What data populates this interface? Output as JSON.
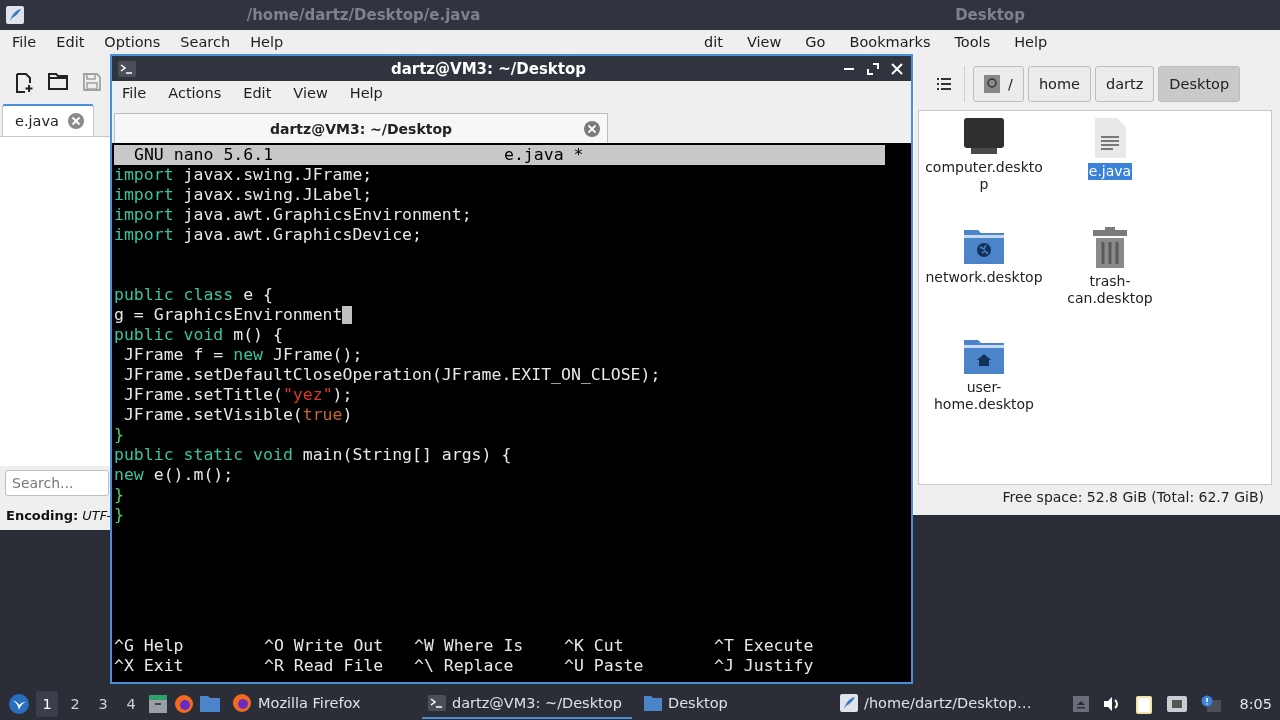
{
  "editor_window": {
    "title": "/home/dartz/Desktop/e.java",
    "menu": [
      "File",
      "Edit",
      "Options",
      "Search",
      "Help"
    ],
    "toolbar": [
      {
        "kind": "new",
        "disabled": false
      },
      {
        "kind": "open",
        "disabled": false
      },
      {
        "kind": "save",
        "disabled": true
      }
    ],
    "tabs": [
      {
        "label": "e.java",
        "selected": true
      }
    ],
    "search": {
      "placeholder": "Search..."
    },
    "status": {
      "label": "Encoding:",
      "value": "UTF-"
    }
  },
  "file_manager": {
    "title": "Desktop",
    "menu": [
      "dit",
      "View",
      "Go",
      "Bookmarks",
      "Tools",
      "Help"
    ],
    "path": [
      {
        "label": "/",
        "kind": "root",
        "selected": false
      },
      {
        "label": "home",
        "kind": "folder",
        "selected": false
      },
      {
        "label": "dartz",
        "kind": "folder",
        "selected": false
      },
      {
        "label": "Desktop",
        "kind": "folder",
        "selected": true
      }
    ],
    "items": [
      {
        "name": "computer.desktop",
        "kind": "computer",
        "selected": false
      },
      {
        "name": "e.java",
        "kind": "document",
        "selected": true
      },
      {
        "name": "network.desktop",
        "kind": "network",
        "selected": false
      },
      {
        "name": "trash-can.desktop",
        "kind": "trash",
        "selected": false
      },
      {
        "name": "user-home.desktop",
        "kind": "home",
        "selected": false
      }
    ],
    "status_bar": "Free space: 52.8 GiB (Total: 62.7 GiB)"
  },
  "terminal": {
    "title": "dartz@VM3: ~/Desktop",
    "menu": [
      "File",
      "Actions",
      "Edit",
      "View",
      "Help"
    ],
    "tabs": [
      {
        "label": "dartz@VM3: ~/Desktop",
        "selected": true
      }
    ],
    "nano": {
      "header_left": "GNU nano 5.6.1",
      "header_file": "e.java *",
      "lines": [
        {
          "cursor": false,
          "segments": [
            {
              "kind": "keyword",
              "text": "import"
            },
            {
              "kind": "plain",
              "text": " javax.swing.JFrame;"
            }
          ]
        },
        {
          "cursor": false,
          "segments": [
            {
              "kind": "keyword",
              "text": "import"
            },
            {
              "kind": "plain",
              "text": " javax.swing.JLabel;"
            }
          ]
        },
        {
          "cursor": false,
          "segments": [
            {
              "kind": "keyword",
              "text": "import"
            },
            {
              "kind": "plain",
              "text": " java.awt.GraphicsEnvironment;"
            }
          ]
        },
        {
          "cursor": false,
          "segments": [
            {
              "kind": "keyword",
              "text": "import"
            },
            {
              "kind": "plain",
              "text": " java.awt.GraphicsDevice;"
            }
          ]
        },
        {
          "cursor": false
        },
        {
          "cursor": false
        },
        {
          "cursor": false,
          "segments": [
            {
              "kind": "keyword",
              "text": "public class"
            },
            {
              "kind": "plain",
              "text": " e {"
            }
          ]
        },
        {
          "cursor": true,
          "segments": [
            {
              "kind": "plain",
              "text": "g = GraphicsEnvironment"
            }
          ]
        },
        {
          "cursor": false,
          "segments": [
            {
              "kind": "keyword",
              "text": "public void"
            },
            {
              "kind": "plain",
              "text": " m() {"
            }
          ]
        },
        {
          "cursor": false,
          "segments": [
            {
              "kind": "plain",
              "text": " JFrame f = "
            },
            {
              "kind": "keyword",
              "text": "new"
            },
            {
              "kind": "plain",
              "text": " JFrame();"
            }
          ]
        },
        {
          "cursor": false,
          "segments": [
            {
              "kind": "plain",
              "text": " JFrame.setDefaultCloseOperation(JFrame.EXIT_ON_CLOSE);"
            }
          ]
        },
        {
          "cursor": false,
          "segments": [
            {
              "kind": "plain",
              "text": " JFrame.setTitle("
            },
            {
              "kind": "string",
              "text": "\"yez\""
            },
            {
              "kind": "plain",
              "text": ");"
            }
          ]
        },
        {
          "cursor": false,
          "segments": [
            {
              "kind": "plain",
              "text": " JFrame.setVisible("
            },
            {
              "kind": "literal",
              "text": "true"
            },
            {
              "kind": "plain",
              "text": ")"
            }
          ]
        },
        {
          "cursor": false,
          "segments": [
            {
              "kind": "bracket",
              "text": "}"
            }
          ]
        },
        {
          "cursor": false,
          "segments": [
            {
              "kind": "keyword",
              "text": "public static void"
            },
            {
              "kind": "plain",
              "text": " main(String[] args) {"
            }
          ]
        },
        {
          "cursor": false,
          "segments": [
            {
              "kind": "keyword",
              "text": "new"
            },
            {
              "kind": "plain",
              "text": " e().m();"
            }
          ]
        },
        {
          "cursor": false,
          "segments": [
            {
              "kind": "bracket",
              "text": "}"
            }
          ]
        },
        {
          "cursor": false,
          "segments": [
            {
              "kind": "bracket",
              "text": "}"
            }
          ]
        }
      ],
      "shortcuts": [
        {
          "key": "^G",
          "label": "Help"
        },
        {
          "key": "^O",
          "label": "Write Out"
        },
        {
          "key": "^W",
          "label": "Where Is"
        },
        {
          "key": "^K",
          "label": "Cut"
        },
        {
          "key": "^T",
          "label": "Execute"
        },
        {
          "key": "^X",
          "label": "Exit"
        },
        {
          "key": "^R",
          "label": "Read File"
        },
        {
          "key": "^\\",
          "label": "Replace"
        },
        {
          "key": "^U",
          "label": "Paste"
        },
        {
          "key": "^J",
          "label": "Justify"
        }
      ]
    }
  },
  "taskbar": {
    "workspaces": [
      {
        "label": "1",
        "selected": true
      },
      {
        "label": "2",
        "selected": false
      },
      {
        "label": "3",
        "selected": false
      },
      {
        "label": "4",
        "selected": false
      }
    ],
    "tasks": [
      {
        "label": "Mozilla Firefox",
        "kind": "firefox",
        "selected": false
      },
      {
        "label": "dartz@VM3: ~/Desktop",
        "kind": "terminal",
        "selected": true
      },
      {
        "label": "Desktop",
        "kind": "folder",
        "selected": false
      },
      {
        "label": "/home/dartz/Desktop…",
        "kind": "editor",
        "selected": false
      }
    ],
    "clock": "8:05"
  }
}
